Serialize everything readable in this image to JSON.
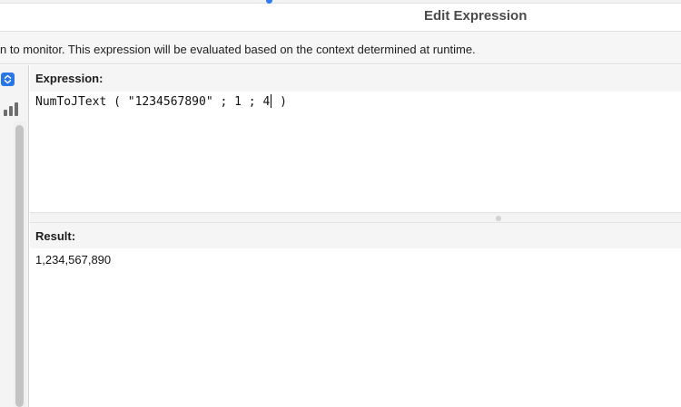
{
  "window": {
    "title": "Edit Expression"
  },
  "description": "n to monitor. This expression will be evaluated based on the context determined at runtime.",
  "sidebar": {
    "stepper_icon": "up-down-chevron-icon",
    "chart_icon": "bar-chart-icon"
  },
  "expression": {
    "label": "Expression:",
    "text_before_caret": "NumToJText ( \"1234567890\" ; 1 ; 4",
    "text_after_caret": " )"
  },
  "result": {
    "label": "Result:",
    "value": "1,234,567,890"
  },
  "colors": {
    "accent": "#2a76e6",
    "panel_bg": "#f5f5f5",
    "text": "#1d1d1f"
  }
}
